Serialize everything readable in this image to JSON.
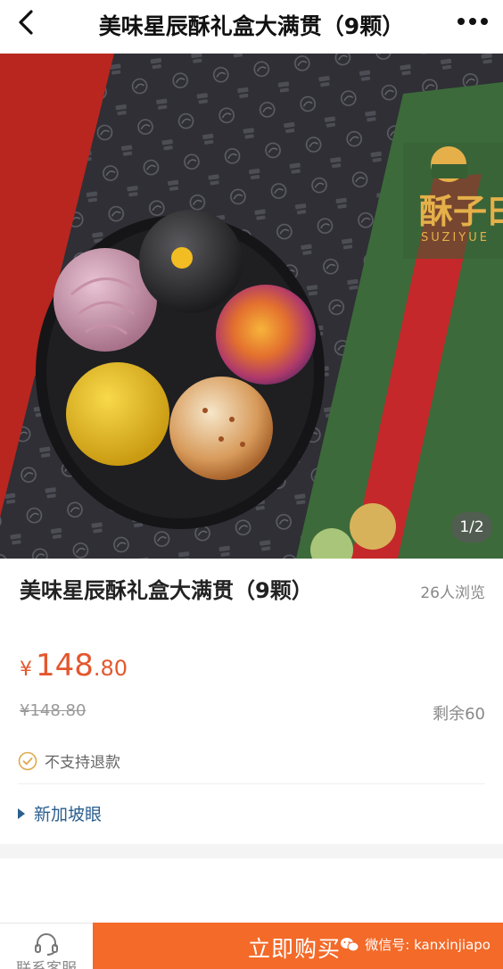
{
  "navbar": {
    "title": "美味星辰酥礼盒大满贯（9颗）",
    "back_icon": "chevron-left-icon",
    "more_icon": "more-dots-icon"
  },
  "hero": {
    "image_counter": "1/2",
    "brand_logo_text": "酥子曰",
    "brand_logo_sub": "SUZIYUE",
    "pattern_text": "SUZI YUE"
  },
  "product": {
    "title": "美味星辰酥礼盒大满贯（9颗）",
    "views": "26人浏览",
    "price": {
      "currency": "¥",
      "integer": "148",
      "decimal": ".80"
    },
    "original_price": "¥148.80",
    "stock": "剩余60",
    "refund_note": "不支持退款",
    "location": "新加坡眼"
  },
  "bottom_bar": {
    "service_label": "联系客服",
    "buy_label": "立即购买",
    "watermark": "微信号: kanxinjiapo"
  },
  "colors": {
    "accent": "#f36a29",
    "price": "#e4572e",
    "link": "#2a5f8f"
  }
}
